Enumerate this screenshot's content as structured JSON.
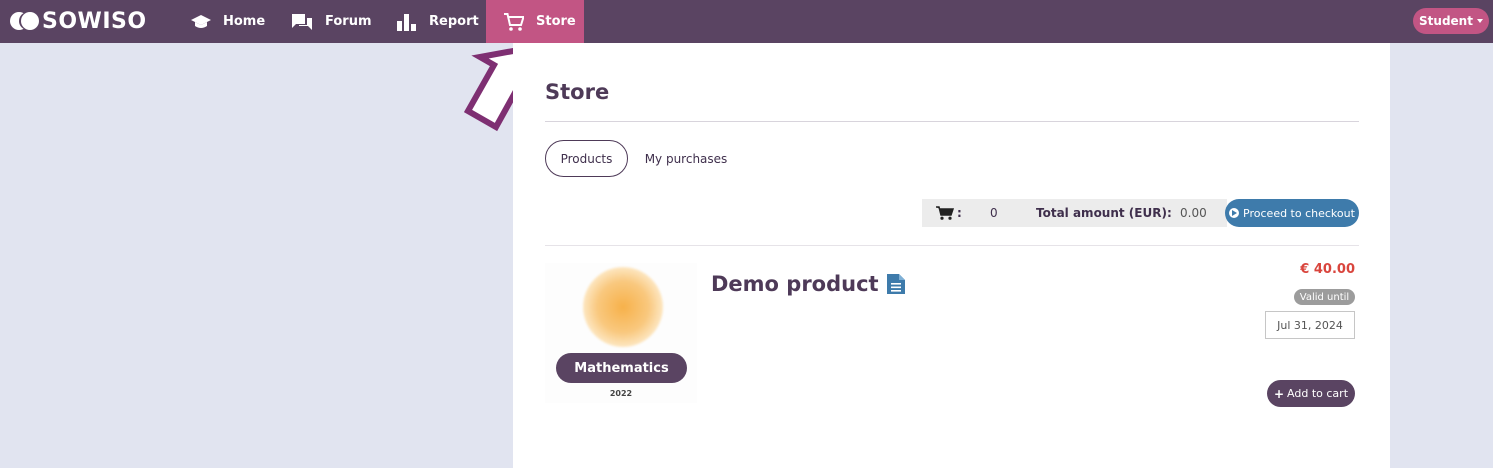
{
  "brand": {
    "name": "SOWISO"
  },
  "nav": {
    "home": "Home",
    "forum": "Forum",
    "report": "Report",
    "store": "Store"
  },
  "user": {
    "label": "Student"
  },
  "page": {
    "title": "Store"
  },
  "tabs": {
    "products": "Products",
    "purchases": "My purchases"
  },
  "cart": {
    "colon": ":",
    "count": "0",
    "total_label": "Total amount (EUR):",
    "total_value": "0.00",
    "checkout_label": "Proceed to checkout"
  },
  "product": {
    "name": "Demo product",
    "subject": "Mathematics",
    "year": "2022",
    "price": "€ 40.00",
    "valid_label": "Valid until",
    "valid_date": "Jul 31, 2024",
    "add_label": "Add to cart"
  },
  "colors": {
    "topbar": "#5a4462",
    "active": "#c25584",
    "checkout": "#3e7bab",
    "price": "#d9453d"
  }
}
